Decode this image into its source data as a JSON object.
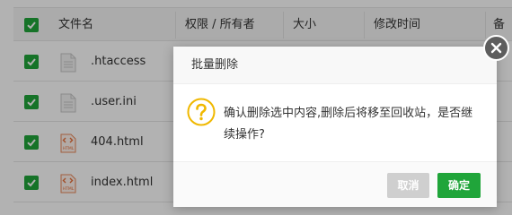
{
  "table": {
    "columns": [
      "文件名",
      "权限 / 所有者",
      "大小",
      "修改时间",
      "备"
    ],
    "rows": [
      {
        "name": ".htaccess",
        "type": "text",
        "edge": "PS"
      },
      {
        "name": ".user.ini",
        "type": "text",
        "edge": "PS"
      },
      {
        "name": "404.html",
        "type": "html",
        "edge": "PS"
      },
      {
        "name": "index.html",
        "type": "html",
        "edge": "PS"
      }
    ],
    "html_icon_text": "HTML"
  },
  "dialog": {
    "title": "批量删除",
    "message": "确认删除选中内容,删除后将移至回收站，是否继续操作?",
    "cancel_label": "取消",
    "ok_label": "确定",
    "icon": "warning-icon",
    "close_icon": "close-icon"
  },
  "colors": {
    "accent": "#20a53a",
    "warning": "#f0b800",
    "cancel": "#cfcfcf"
  }
}
